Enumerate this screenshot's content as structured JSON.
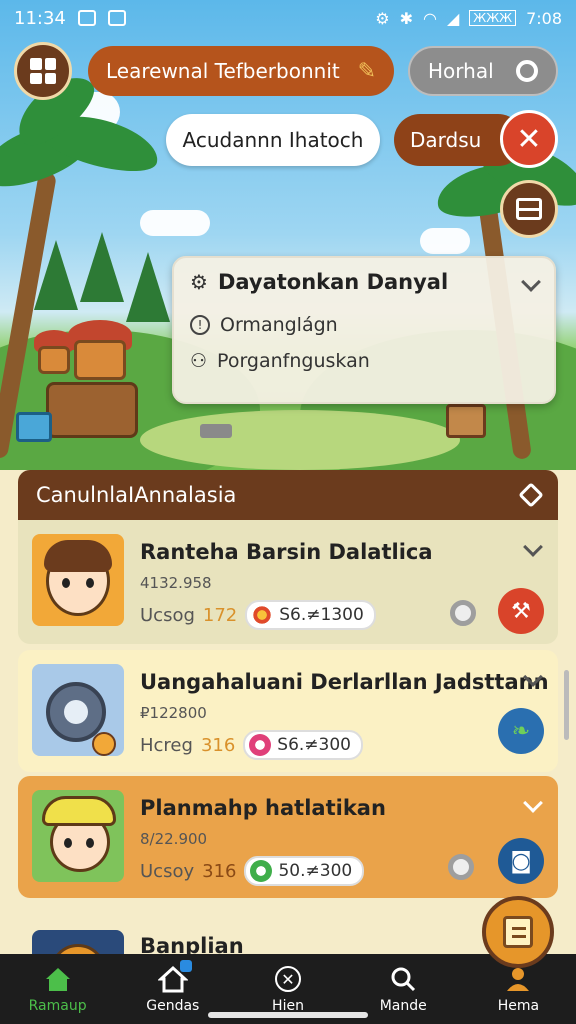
{
  "status_bar": {
    "time": "11:34",
    "right_text": "7:08",
    "battery_label": "ЖЖЖ"
  },
  "top_bar": {
    "search_pill_label": "Learewnal Tefberbonnit",
    "right_pill_label": "Horhal",
    "hint_pill_label": "Acudannn Ihatoch",
    "dismiss_pill_label": "Dardsu"
  },
  "dropdown": {
    "title": "Dayatonkan Danyal",
    "items": [
      "Ormanglágn",
      "Porganfnguskan"
    ]
  },
  "list": {
    "header": "CanulnlaIAnnalasia",
    "cards": [
      {
        "title": "Ranteha Barsin Dalatlica",
        "sub": "4132.958",
        "meta_label": "Ucsog",
        "meta_value": "172",
        "price": "S6.≠1300",
        "bg": "#e8e3bd",
        "action_color": "#d9442a",
        "price_color": "#e04a2a"
      },
      {
        "title": "Uangahaluani Derlarllan Jadsttann",
        "sub": "₽122800",
        "meta_label": "Hcreg",
        "meta_value": "316",
        "price": "S6.≠300",
        "bg": "#fbf1c4",
        "action_color": "#2a6fb0",
        "price_color": "#e0407a"
      },
      {
        "title": "Planmahp hatlatikan",
        "sub": "8/22.900",
        "meta_label": "Ucsoy",
        "meta_value": "316",
        "price": "50.≠300",
        "bg": "#eaa34a",
        "action_color": "#1f5a96",
        "price_color": "#3fae4a"
      },
      {
        "title": "Banplian"
      }
    ]
  },
  "bottom_nav": {
    "items": [
      {
        "label": "Ramaup",
        "icon": "home-icon"
      },
      {
        "label": "Gendas",
        "icon": "house-badge-icon"
      },
      {
        "label": "Hien",
        "icon": "close-circle-icon"
      },
      {
        "label": "Mande",
        "icon": "search-icon"
      },
      {
        "label": "Hema",
        "icon": "profile-icon"
      }
    ]
  },
  "colors": {
    "brand_brown": "#6b3b1d",
    "accent_orange": "#e6962a",
    "pill_rust": "#b5541c",
    "danger_red": "#d9442a",
    "active_green": "#4cbf4a"
  }
}
